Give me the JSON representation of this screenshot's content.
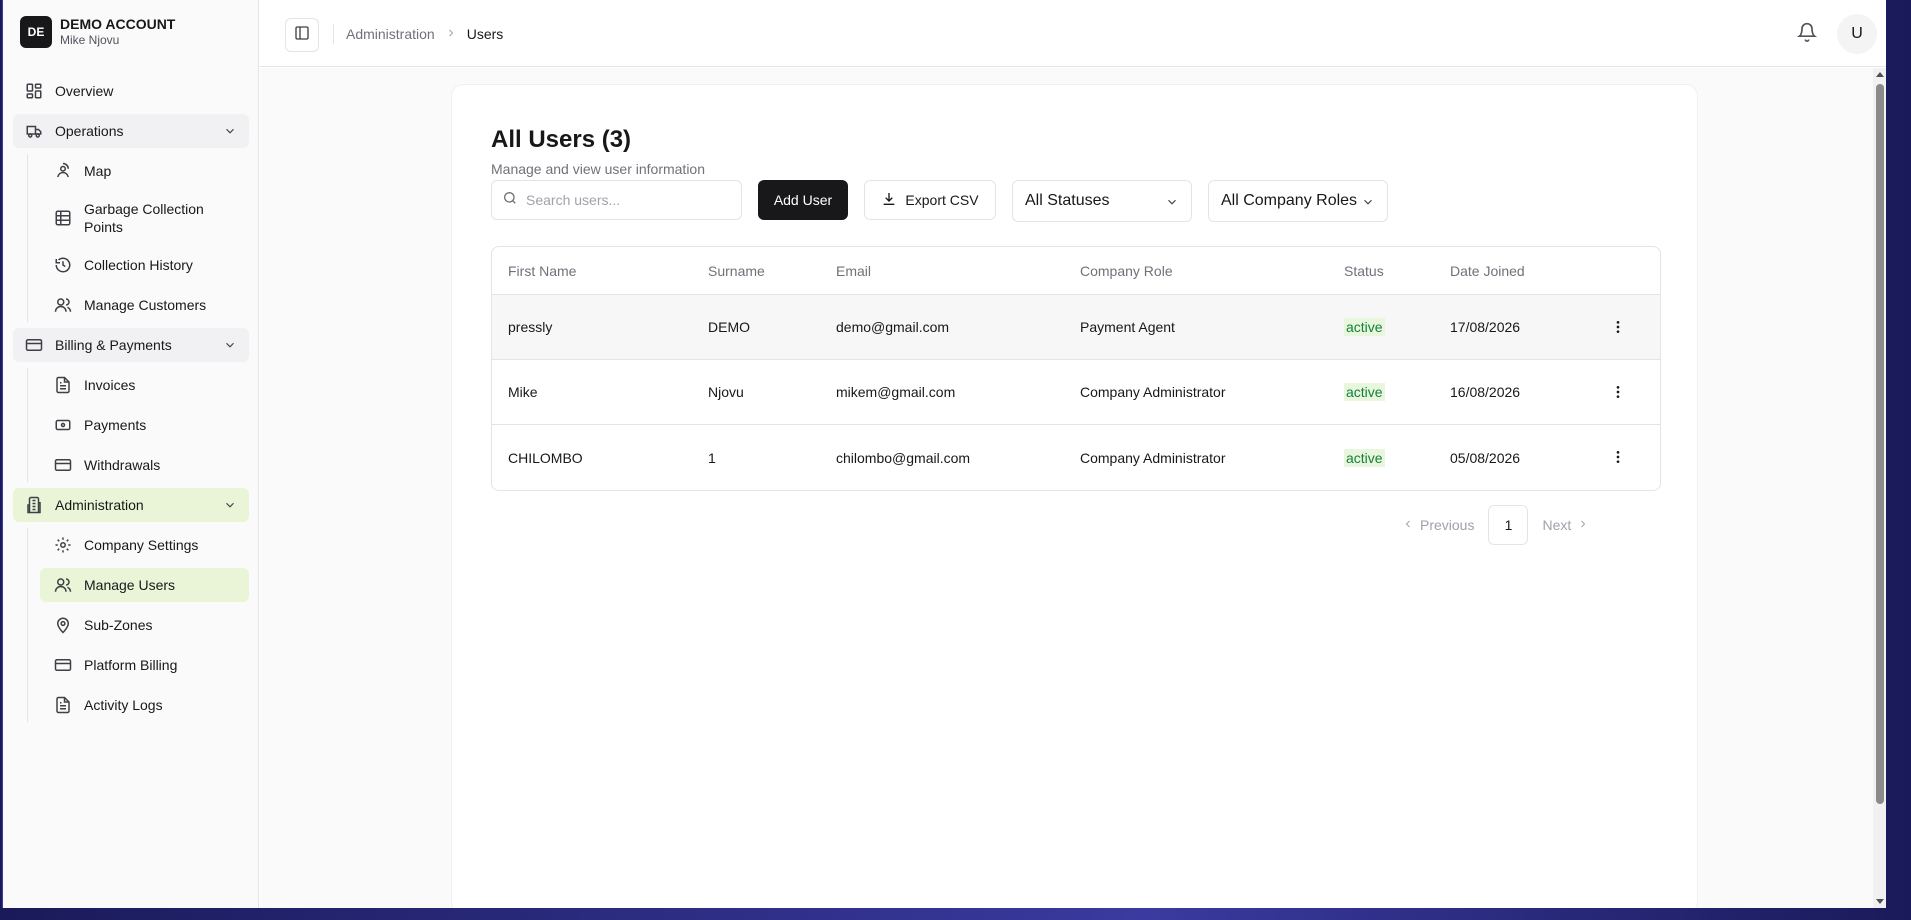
{
  "account": {
    "initials": "DE",
    "name": "DEMO ACCOUNT",
    "user": "Mike Njovu"
  },
  "sidebar": {
    "overview": "Overview",
    "operations": {
      "label": "Operations",
      "items": [
        "Map",
        "Garbage Collection Points",
        "Collection History",
        "Manage Customers"
      ]
    },
    "billing": {
      "label": "Billing & Payments",
      "items": [
        "Invoices",
        "Payments",
        "Withdrawals"
      ]
    },
    "administration": {
      "label": "Administration",
      "items": [
        "Company Settings",
        "Manage Users",
        "Sub-Zones",
        "Platform Billing",
        "Activity Logs"
      ],
      "active": "Manage Users"
    }
  },
  "header": {
    "breadcrumb": [
      "Administration",
      "Users"
    ],
    "user_initial": "U"
  },
  "page": {
    "title": "All Users (3)",
    "subtitle": "Manage and view user information",
    "search_placeholder": "Search users...",
    "add_user": "Add User",
    "export_csv": "Export CSV",
    "status_filter": "All Statuses",
    "role_filter": "All Company Roles"
  },
  "table": {
    "columns": [
      "First Name",
      "Surname",
      "Email",
      "Company Role",
      "Status",
      "Date Joined"
    ],
    "rows": [
      {
        "first": "pressly",
        "surname": "DEMO",
        "email": "demo@gmail.com",
        "role": "Payment Agent",
        "status": "active",
        "joined": "17/08/2026"
      },
      {
        "first": "Mike",
        "surname": "Njovu",
        "email": "mikem@gmail.com",
        "role": "Company Administrator",
        "status": "active",
        "joined": "16/08/2026"
      },
      {
        "first": "CHILOMBO",
        "surname": "1",
        "email": "chilombo@gmail.com",
        "role": "Company Administrator",
        "status": "active",
        "joined": "05/08/2026"
      }
    ]
  },
  "pagination": {
    "previous": "Previous",
    "current": "1",
    "next": "Next"
  },
  "colors": {
    "accent": "#18181b",
    "active_bg": "#eaf5d8",
    "status_text": "#15803d"
  }
}
